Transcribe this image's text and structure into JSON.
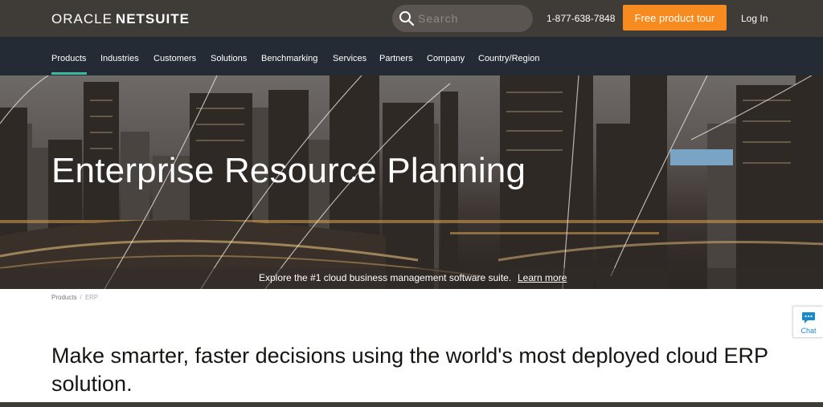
{
  "header": {
    "logo_part1": "ORACLE",
    "logo_part2": "NETSUITE",
    "search_placeholder": "Search",
    "phone": "1-877-638-7848",
    "tour_button": "Free product tour",
    "login": "Log In"
  },
  "nav": {
    "items": [
      "Products",
      "Industries",
      "Customers",
      "Solutions",
      "Benchmarking",
      "Services",
      "Partners",
      "Company",
      "Country/Region"
    ],
    "active": "Products"
  },
  "hero": {
    "title": "Enterprise Resource Planning",
    "subtitle": "Explore the #1 cloud business management software suite.",
    "link": "Learn more"
  },
  "breadcrumb": {
    "items": [
      "Products",
      "ERP"
    ],
    "separator": "/"
  },
  "chat": {
    "label": "Chat"
  },
  "main": {
    "headline": "Make smarter, faster decisions using the world's most deployed cloud ERP solution."
  },
  "colors": {
    "topbar": "#3f3b37",
    "nav": "#252b35",
    "accent_orange": "#f78b1f",
    "nav_underline": "#3fb8a1",
    "chat_blue": "#1a8acb"
  },
  "icons": {
    "search": "search-icon",
    "chat": "chat-bubble-icon"
  }
}
